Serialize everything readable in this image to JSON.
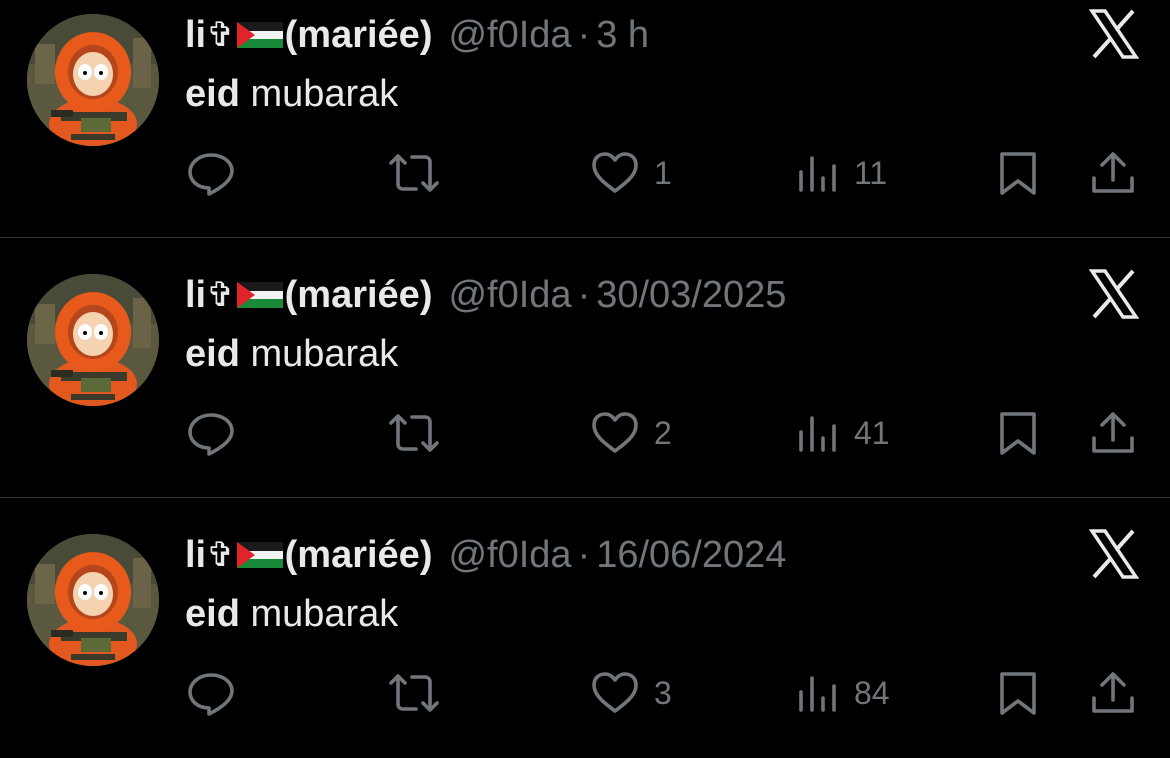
{
  "colors": {
    "background": "#000000",
    "text_primary": "#e7e9ea",
    "text_secondary": "#71767b",
    "divider": "#2f3336"
  },
  "tweets": [
    {
      "display_name": "li",
      "name_symbol": "✞",
      "flag_icon": "palestine-flag-icon",
      "name_suffix": "(mariée)",
      "handle": "@f0Ida",
      "separator": "·",
      "time": "3 h",
      "text_bold": "eid",
      "text_rest": " mubarak",
      "likes": "1",
      "views": "11"
    },
    {
      "display_name": "li",
      "name_symbol": "✞",
      "flag_icon": "palestine-flag-icon",
      "name_suffix": "(mariée)",
      "handle": "@f0Ida",
      "separator": "·",
      "time": "30/03/2025",
      "text_bold": "eid",
      "text_rest": " mubarak",
      "likes": "2",
      "views": "41"
    },
    {
      "display_name": "li",
      "name_symbol": "✞",
      "flag_icon": "palestine-flag-icon",
      "name_suffix": "(mariée)",
      "handle": "@f0Ida",
      "separator": "·",
      "time": "16/06/2024",
      "text_bold": "eid",
      "text_rest": " mubarak",
      "likes": "3",
      "views": "84"
    }
  ]
}
